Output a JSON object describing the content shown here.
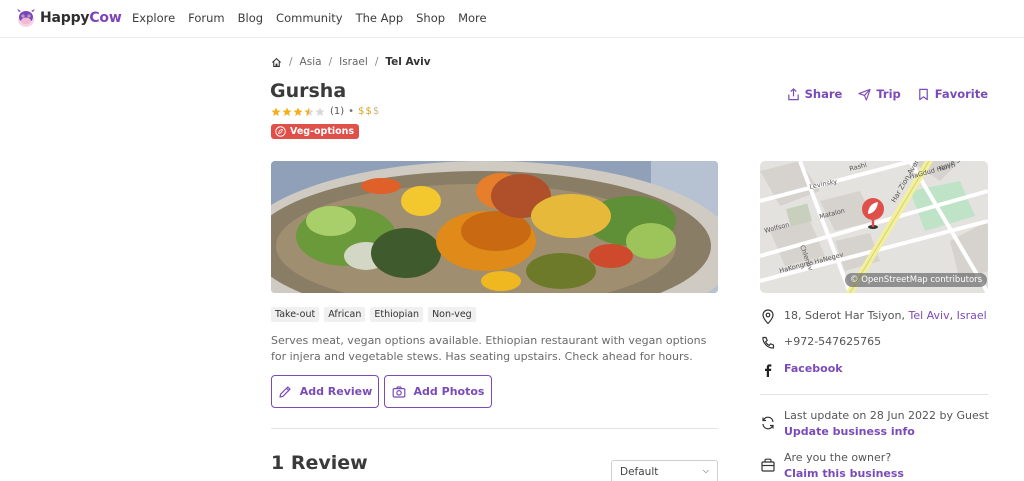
{
  "brand": {
    "happy": "Happy",
    "cow": "Cow"
  },
  "nav": {
    "items": [
      "Explore",
      "Forum",
      "Blog",
      "Community",
      "The App",
      "Shop",
      "More"
    ]
  },
  "breadcrumb": {
    "home_icon": "home-icon",
    "items": [
      "Asia",
      "Israel"
    ],
    "current": "Tel Aviv"
  },
  "listing": {
    "name": "Gursha",
    "rating": 3.5,
    "rating_count": "(1)",
    "price_dots": "•",
    "price_filled": "$$",
    "price_dim": "$",
    "badge": "Veg-options",
    "badge_color": "#e0504b"
  },
  "actions": {
    "share": "Share",
    "trip": "Trip",
    "favorite": "Favorite"
  },
  "tags": [
    "Take-out",
    "African",
    "Ethiopian",
    "Non-veg"
  ],
  "description": "Serves meat, vegan options available. Ethiopian restaurant with vegan options for injera and vegetable stews. Has seating upstairs. Check ahead for hours.",
  "buttons": {
    "add_review": "Add Review",
    "add_photos": "Add Photos"
  },
  "reviews": {
    "heading": "1 Review",
    "sort_selected": "Default"
  },
  "map": {
    "attribution": "© OpenStreetMap contributors",
    "streets": [
      "Rashi",
      "Levinsky",
      "Har Zion Avenue",
      "HaGdud HaIvri",
      "Nave Sha'anan",
      "Matalon",
      "Wolfson",
      "Chlenov",
      "HaNegev",
      "HaKongres"
    ]
  },
  "info": {
    "address_prefix": "18, Sderot Har Tsiyon,",
    "address_city": "Tel Aviv",
    "address_country": "Israel",
    "phone": "+972-547625765",
    "facebook": "Facebook",
    "last_update": "Last update on 28 Jun 2022 by Guest",
    "update_link": "Update business info",
    "owner_question": "Are you the owner?",
    "claim_link": "Claim this business"
  },
  "colors": {
    "brand_purple": "#7a4bb8",
    "star": "#f2b01e",
    "price": "#d9a21b"
  }
}
